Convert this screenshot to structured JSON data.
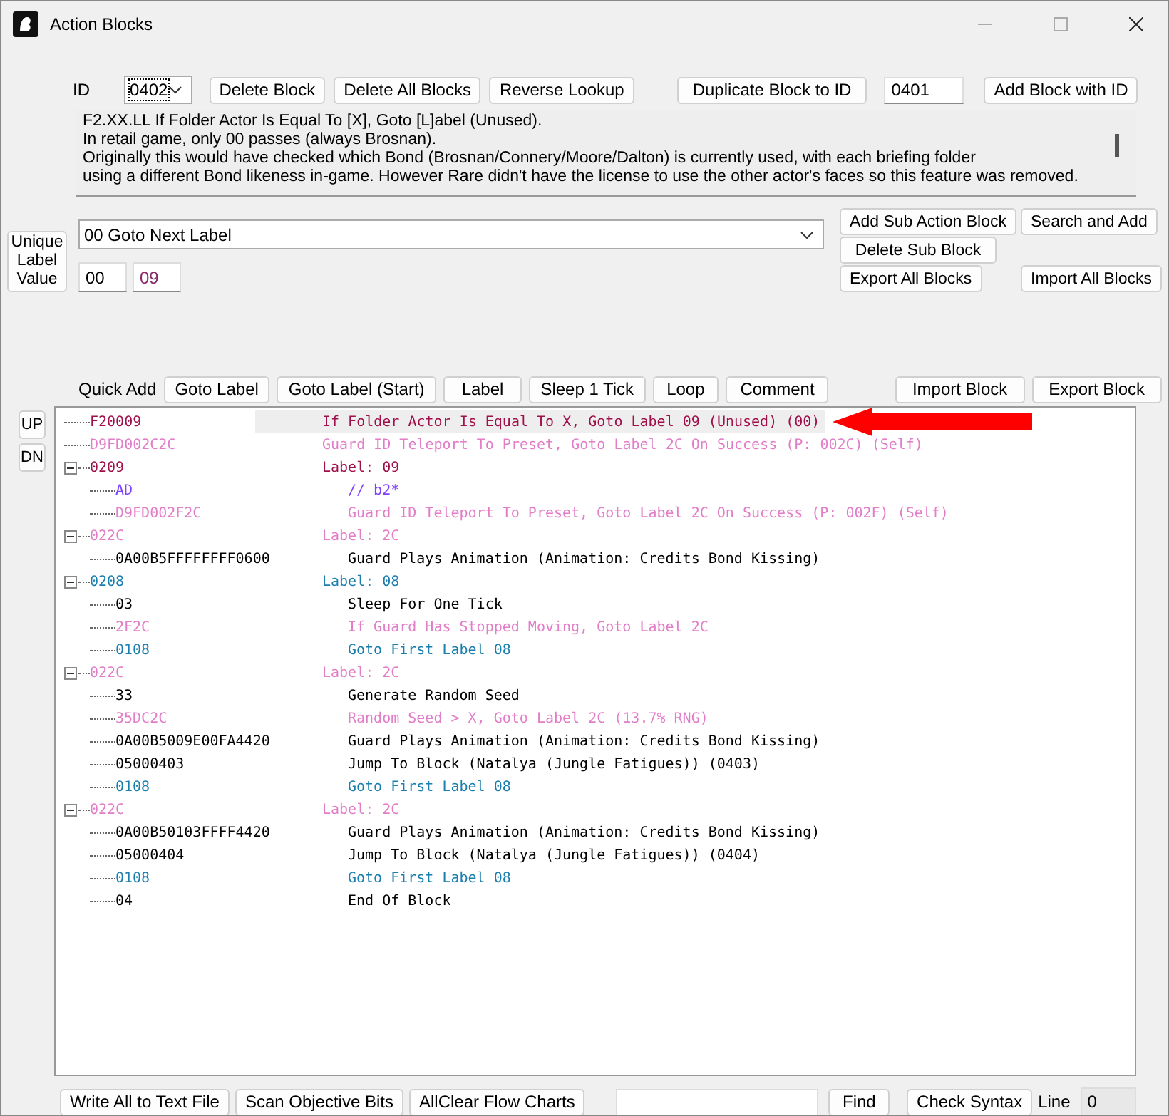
{
  "window": {
    "title": "Action Blocks"
  },
  "id_row": {
    "label": "ID",
    "id_value": "0402",
    "buttons": [
      "Delete Block",
      "Delete All Blocks",
      "Reverse Lookup",
      "Duplicate Block to ID"
    ],
    "target_id": "0401",
    "add_button": "Add Block with ID"
  },
  "description": [
    "F2.XX.LL If Folder Actor Is Equal To [X], Goto [L]abel (Unused).",
    "In retail game, only 00 passes (always Brosnan).",
    "Originally this would have checked which Bond (Brosnan/Connery/Moore/Dalton) is currently used, with each briefing folder",
    "using a different Bond likeness in-game. However Rare didn't have the license to use the other actor's faces so this feature was removed."
  ],
  "command_select": "00 Goto Next Label",
  "unique_label": {
    "label": "Unique Label Value",
    "values": [
      "00",
      "09"
    ]
  },
  "side_buttons": [
    "Add Sub Action Block",
    "Search and Add",
    "Delete Sub Block",
    "Export All Blocks",
    "Import All Blocks"
  ],
  "quick_add": {
    "label": "Quick Add",
    "buttons": [
      "Goto Label",
      "Goto Label (Start)",
      "Label",
      "Sleep 1 Tick",
      "Loop",
      "Comment"
    ]
  },
  "block_buttons": [
    "Import Block",
    "Export Block"
  ],
  "move_buttons": [
    "UP",
    "DN"
  ],
  "tree": [
    {
      "code": "F20009",
      "text": "If Folder Actor Is Equal To X, Goto Label 09 (Unused) (00)",
      "color": "#a0104a",
      "selected": true
    },
    {
      "code": "D9FD002C2C",
      "text": "Guard ID Teleport To Preset, Goto Label 2C On Success (P: 002C) (Self)",
      "color": "#e27ec8",
      "selected": false
    },
    {
      "code": "0209",
      "text": "Label: 09",
      "color": "#a0104a",
      "selected": false,
      "expanded": true,
      "children": [
        {
          "code": "AD",
          "text": "// b2*",
          "color": "#8040ff",
          "selected": false
        },
        {
          "code": "D9FD002F2C",
          "text": "Guard ID Teleport To Preset, Goto Label 2C On Success (P: 002F) (Self)",
          "color": "#e27ec8",
          "selected": false
        }
      ]
    },
    {
      "code": "022C",
      "text": "Label: 2C",
      "color": "#e27ec8",
      "selected": false,
      "expanded": true,
      "children": [
        {
          "code": "0A00B5FFFFFFFF0600",
          "text": "Guard Plays Animation (Animation: Credits Bond Kissing)",
          "color": "#000000",
          "selected": false
        }
      ]
    },
    {
      "code": "0208",
      "text": "Label: 08",
      "color": "#1a7fae",
      "selected": false,
      "expanded": true,
      "children": [
        {
          "code": "03",
          "text": "Sleep For One Tick",
          "color": "#000000",
          "selected": false
        },
        {
          "code": "2F2C",
          "text": "If Guard Has Stopped Moving, Goto Label 2C",
          "color": "#e27ec8",
          "selected": false
        },
        {
          "code": "0108",
          "text": "Goto First Label 08",
          "color": "#1a7fae",
          "selected": false
        }
      ]
    },
    {
      "code": "022C",
      "text": "Label: 2C",
      "color": "#e27ec8",
      "selected": false,
      "expanded": true,
      "children": [
        {
          "code": "33",
          "text": "Generate Random Seed",
          "color": "#000000",
          "selected": false
        },
        {
          "code": "35DC2C",
          "text": "Random Seed > X, Goto Label 2C (13.7% RNG)",
          "color": "#e27ec8",
          "selected": false
        },
        {
          "code": "0A00B5009E00FA4420",
          "text": "Guard Plays Animation (Animation: Credits Bond Kissing)",
          "color": "#000000",
          "selected": false
        },
        {
          "code": "05000403",
          "text": "Jump To Block (Natalya (Jungle Fatigues)) (0403)",
          "color": "#000000",
          "selected": false
        },
        {
          "code": "0108",
          "text": "Goto First Label 08",
          "color": "#1a7fae",
          "selected": false
        }
      ]
    },
    {
      "code": "022C",
      "text": "Label: 2C",
      "color": "#e27ec8",
      "selected": false,
      "expanded": true,
      "children": [
        {
          "code": "0A00B50103FFFF4420",
          "text": "Guard Plays Animation (Animation: Credits Bond Kissing)",
          "color": "#000000",
          "selected": false
        },
        {
          "code": "05000404",
          "text": "Jump To Block (Natalya (Jungle Fatigues)) (0404)",
          "color": "#000000",
          "selected": false
        },
        {
          "code": "0108",
          "text": "Goto First Label 08",
          "color": "#1a7fae",
          "selected": false
        },
        {
          "code": "04",
          "text": "End Of Block",
          "color": "#000000",
          "selected": false
        }
      ]
    }
  ],
  "bottom": {
    "buttons": [
      "Write All to Text File",
      "Scan Objective Bits",
      "AllClear Flow Charts"
    ],
    "find_button": "Find",
    "check_button": "Check Syntax",
    "line_label": "Line",
    "line_value": "0"
  }
}
